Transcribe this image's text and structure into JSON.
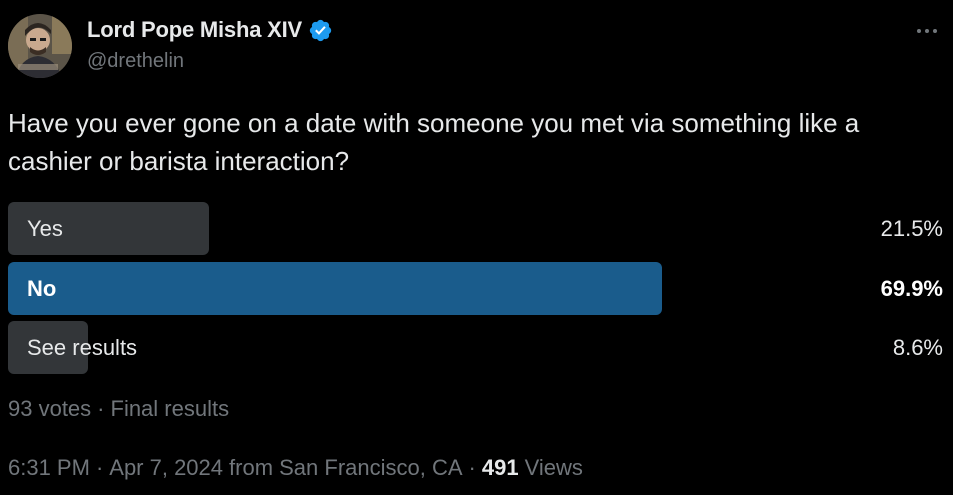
{
  "author": {
    "display_name": "Lord Pope Misha XIV",
    "handle": "@drethelin",
    "verified": true,
    "verified_color": "#1d9bf0"
  },
  "more_icon": "more-horizontal-icon",
  "tweet": {
    "text": "Have you ever gone on a date with someone you met via something like a cashier or barista interaction?"
  },
  "poll": {
    "options": [
      {
        "label": "Yes",
        "percent_label": "21.5%",
        "percent": 21.5,
        "winner": false
      },
      {
        "label": "No",
        "percent_label": "69.9%",
        "percent": 69.9,
        "winner": true
      },
      {
        "label": "See results",
        "percent_label": "8.6%",
        "percent": 8.6,
        "winner": false
      }
    ],
    "votes": "93 votes",
    "separator": "·",
    "status": "Final results"
  },
  "meta": {
    "time": "6:31 PM",
    "separator": "·",
    "date": "Apr 7, 2024",
    "source": "from San Francisco, CA",
    "views_count": "491",
    "views_label": "Views"
  },
  "colors": {
    "background": "#000000",
    "text": "#e7e9ea",
    "muted": "#71767b",
    "bar": "#333639",
    "winner_bar": "#1a5c8c"
  }
}
